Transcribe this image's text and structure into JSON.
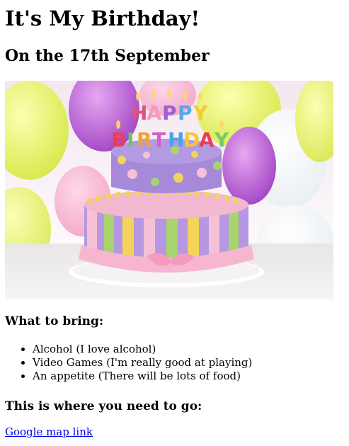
{
  "title": "It's My Birthday!",
  "subtitle": "On the 17th September",
  "image": {
    "candle_letters_line1": [
      "H",
      "A",
      "P",
      "P",
      "Y"
    ],
    "candle_letters_line2": [
      "B",
      "I",
      "R",
      "T",
      "H",
      "D",
      "A",
      "Y"
    ],
    "colors": {
      "cake_purple": "#a78bd8",
      "cake_pink": "#f7b6cf",
      "cake_yellow": "#f3d35a",
      "cake_green": "#a6d46d",
      "balloon_yellow": "#ecf36b",
      "balloon_purple": "#c06ad6",
      "balloon_pink": "#f7a7c9"
    }
  },
  "bring": {
    "heading": "What to bring:",
    "items": [
      "Alcohol (I love alcohol)",
      "Video Games (I'm really good at playing)",
      "An appetite (There will be lots of food)"
    ]
  },
  "directions": {
    "heading": "This is where you need to go:",
    "link_text": "Google map link"
  }
}
